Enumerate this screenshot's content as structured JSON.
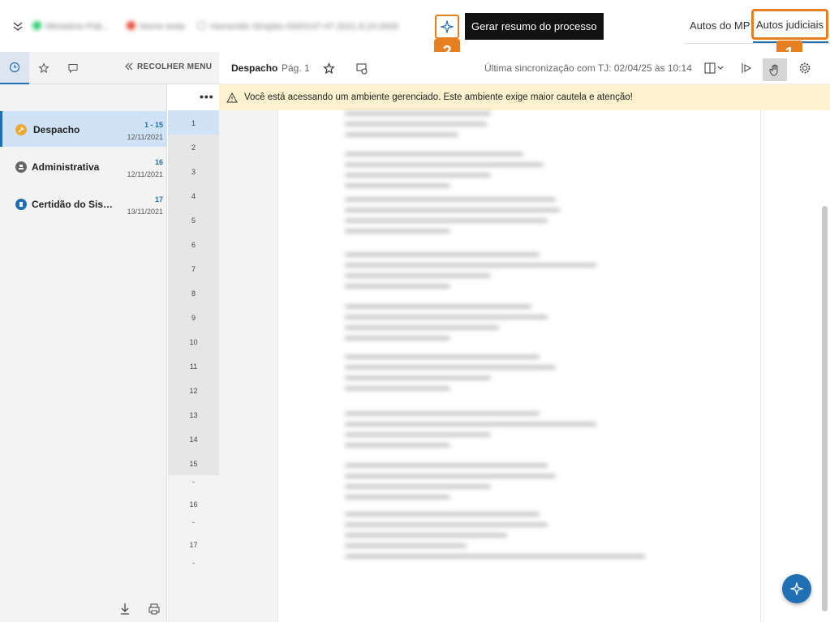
{
  "header": {
    "blurred_org": "Ministério Púb...",
    "blurred_name": "Nome teste",
    "blurred_case": "Homicídio Simples 0000147-47.2021.8.24.0000",
    "ai_tooltip": "Gerar resumo do processo",
    "tabs": [
      {
        "label": "Autos do MP"
      },
      {
        "label": "Autos judiciais"
      }
    ],
    "badge1": "1",
    "badge2": "2"
  },
  "sidebar": {
    "collapse_label": "RECOLHER MENU",
    "more": "•••",
    "documents": [
      {
        "name": "Despacho",
        "range": "1 - 15",
        "date": "12/11/2021",
        "icon_color": "#f0a830"
      },
      {
        "name": "Administrativa",
        "range": "16",
        "date": "12/11/2021",
        "icon_color": "#666666"
      },
      {
        "name": "Certidão do Sistema",
        "range": "17",
        "date": "13/11/2021",
        "icon_color": "#1f6fb5"
      }
    ],
    "pages": [
      "1",
      "2",
      "3",
      "4",
      "5",
      "6",
      "7",
      "8",
      "9",
      "10",
      "11",
      "12",
      "13",
      "14",
      "15",
      "-",
      "16",
      "-",
      "17",
      "-"
    ]
  },
  "document": {
    "title": "Despacho",
    "page": "Pág. 1",
    "sync": "Última sincronização com TJ: 02/04/25 às 10:14"
  },
  "warning": "Você está acessando um ambiente gerenciado. Este ambiente exige maior cautela e atenção!",
  "colors": {
    "accent": "#1f6fb5",
    "highlight": "#e67e22",
    "warning_bg": "#fdf1cf"
  }
}
